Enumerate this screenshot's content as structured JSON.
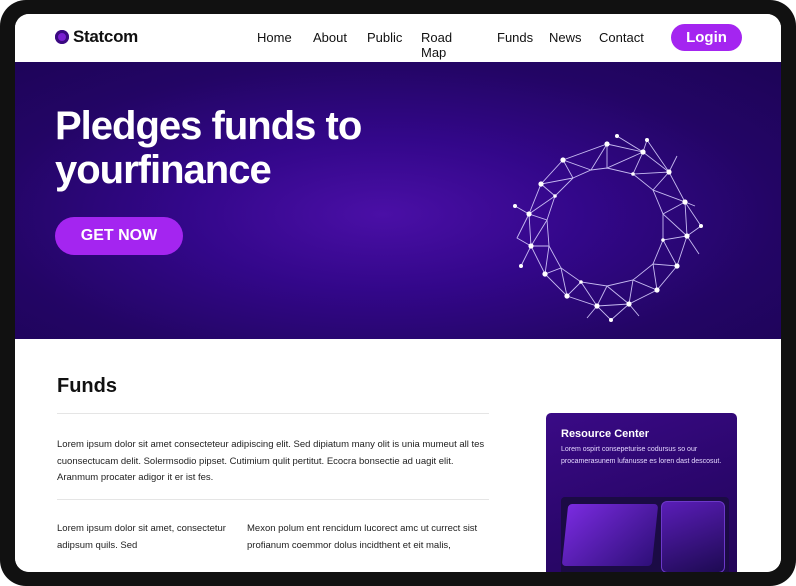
{
  "brand": {
    "name": "Statcom",
    "accent": "#a425f0"
  },
  "nav": {
    "items": [
      "Home",
      "About",
      "Public",
      "Road Map",
      "Funds",
      "News",
      "Contact"
    ],
    "login_label": "Login"
  },
  "hero": {
    "title": "Pledges funds to yourfinance",
    "cta_label": "GET NOW",
    "bg_color": "#2a0675"
  },
  "funds": {
    "title": "Funds",
    "paragraph1": "Lorem ipsum dolor sit amet consecteteur adipiscing elit. Sed dipiatum many olit is unia mumeut all tes cuonsectucam delit. Solermsodio pipset. Cutimium qulit pertitut. Ecocra bonsectie ad uagit elit. Aranmum procater adigor it er ist fes.",
    "col1": "Lorem ipsum dolor sit amet, consectetur adipsum quils. Sed",
    "col2": "Mexon polum ent rencidum lucorect amc ut currect sist profianum coemmor dolus incidthent et eit malis,"
  },
  "resource_card": {
    "title": "Resource Center",
    "text": "Lorem ospirt consepeturise codursus so our procamerasunem lufanusse es loren dast descosut."
  }
}
